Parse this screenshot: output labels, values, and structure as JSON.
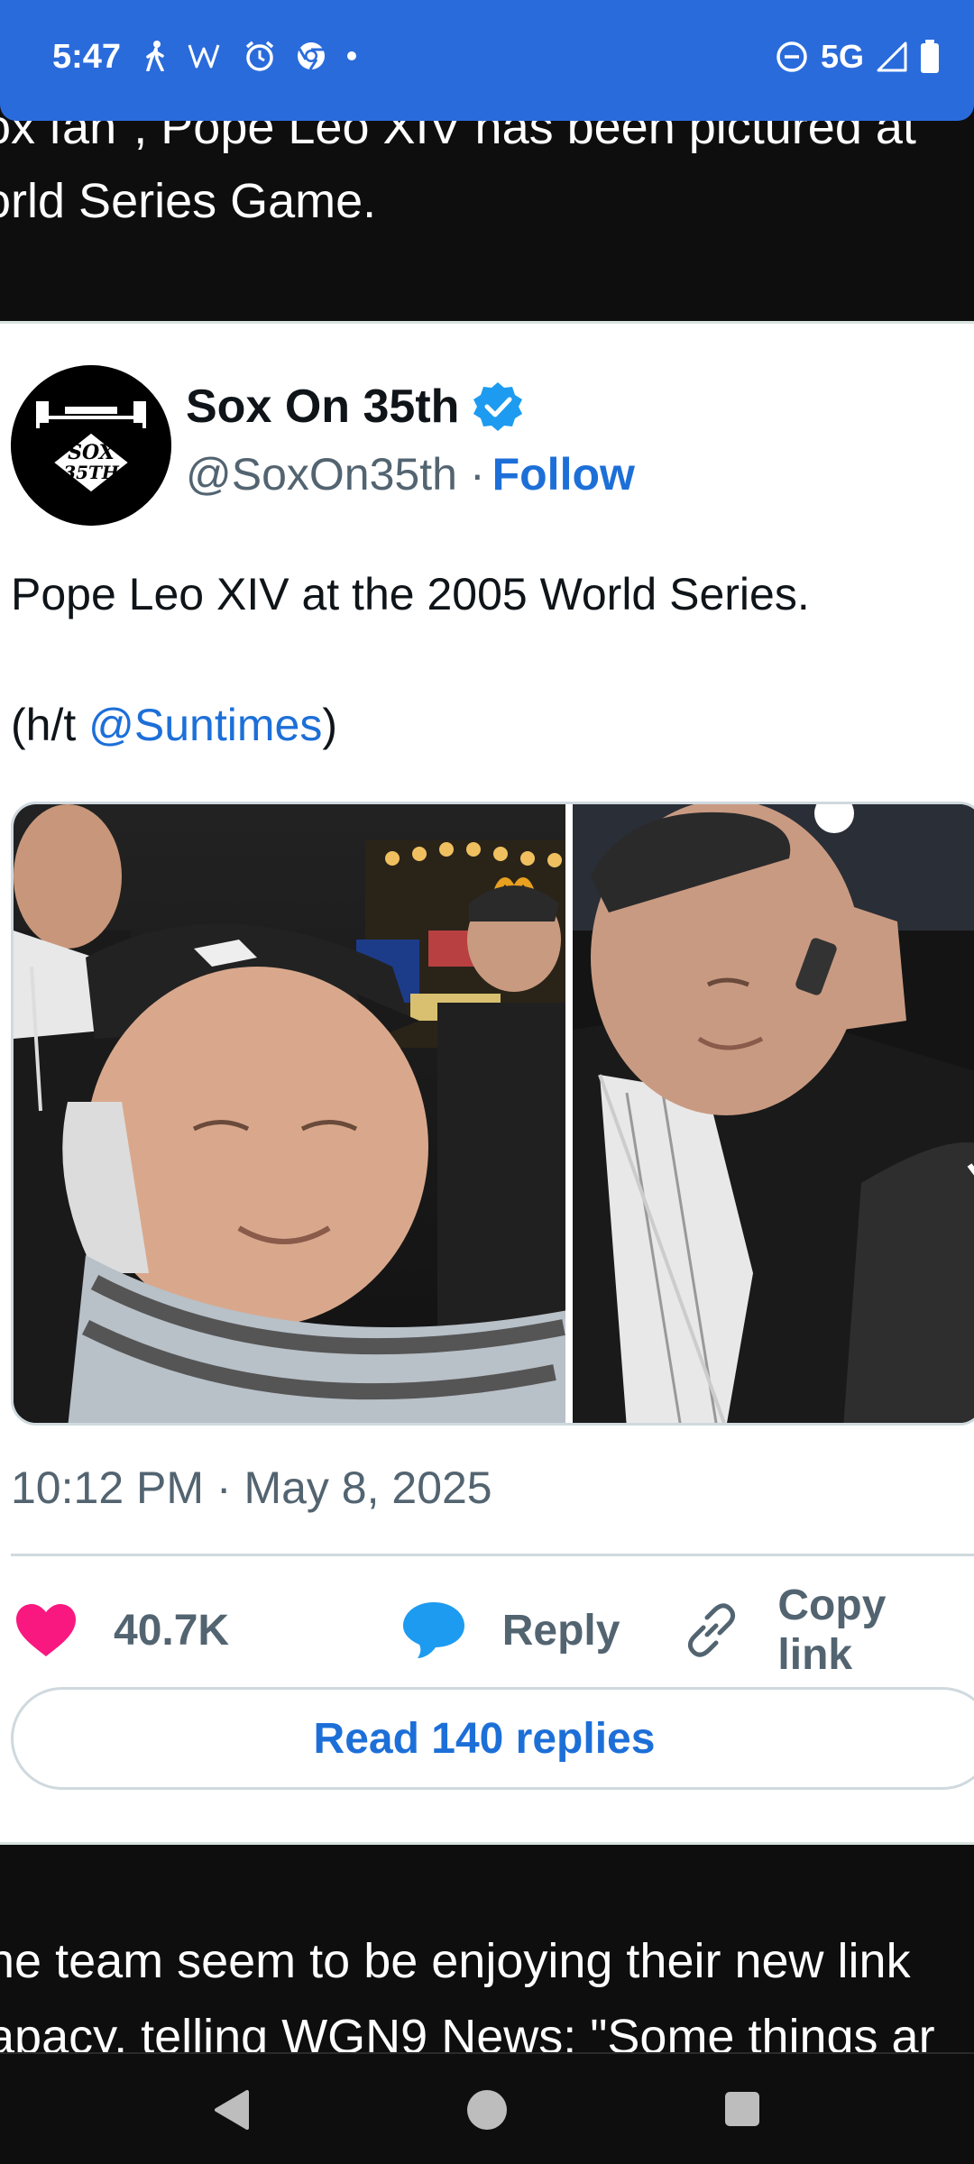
{
  "status_bar": {
    "time": "5:47",
    "network": "5G",
    "left_icons": [
      "walk-icon",
      "w-icon",
      "alarm-icon",
      "chrome-icon",
      "dot-icon"
    ],
    "right_icons": [
      "dnd-icon",
      "signal-icon",
      "battery-icon"
    ]
  },
  "article": {
    "top_line_1": "ox fan\", Pope Leo XIV has been pictured at",
    "top_line_2": "orld Series Game.",
    "bottom_line_1": "he team seem to be enjoying their new link",
    "bottom_line_2": "apacy, telling WGN9 News: \"Some things ar"
  },
  "tweet": {
    "author_name": "Sox On 35th",
    "handle": "@SoxOn35th",
    "separator": "·",
    "follow_label": "Follow",
    "text_line_1": "Pope Leo XIV at the 2005 World Series.",
    "text_hat_prefix": "(h/t ",
    "text_mention": "@Suntimes",
    "text_hat_suffix": ")",
    "timestamp": "10:12 PM · May 8, 2025",
    "likes": "40.7K",
    "reply_label": "Reply",
    "copy_link_label": "Copy link",
    "read_replies_label": "Read 140 replies"
  },
  "colors": {
    "status_bar": "#2a6bdc",
    "link": "#1d6fd8",
    "like_heart": "#f91880",
    "reply_bubble": "#1d9bf0",
    "verified": "#1d9bf0"
  }
}
